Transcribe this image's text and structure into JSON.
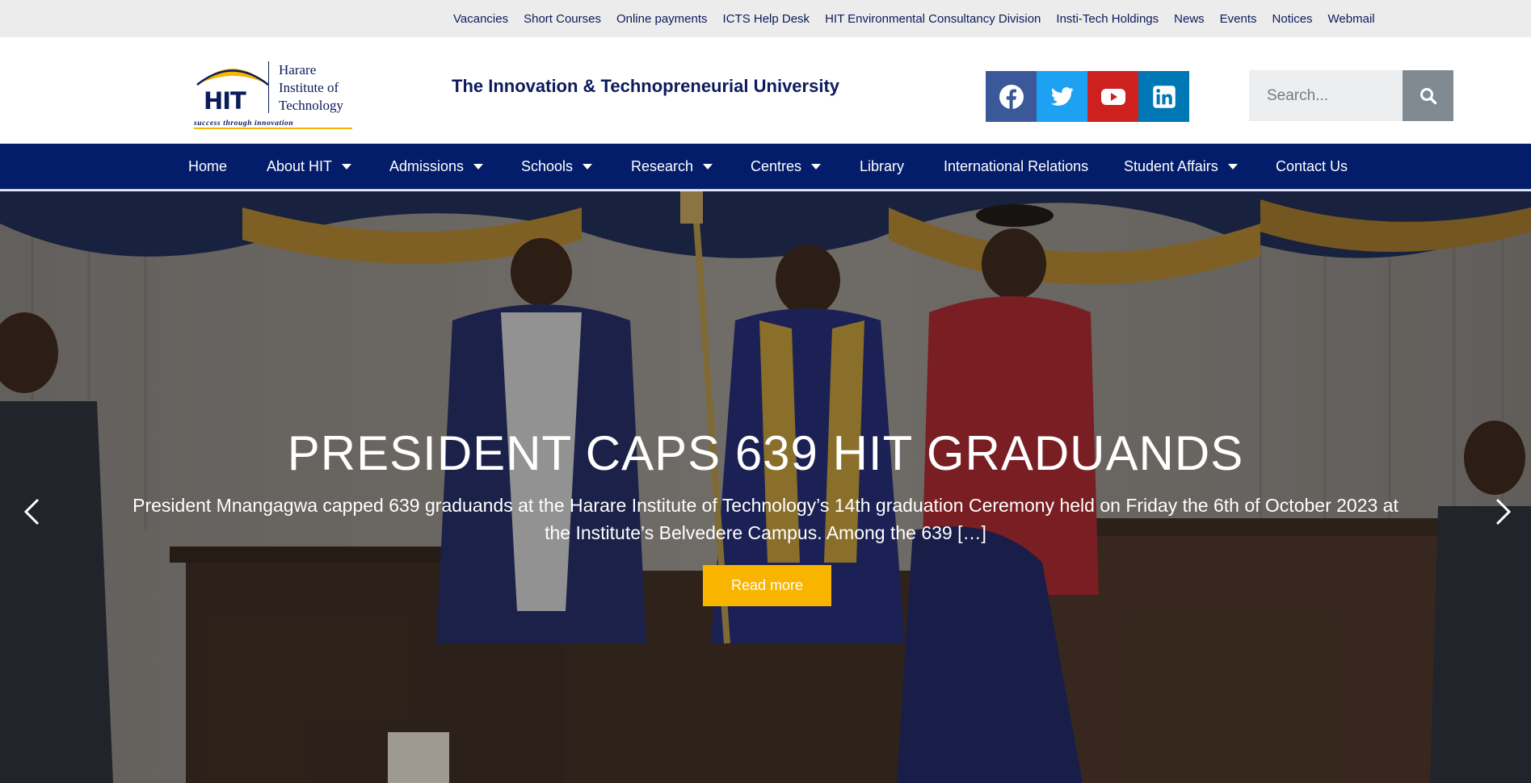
{
  "topbar": {
    "links": [
      "Vacancies",
      "Short Courses",
      "Online payments",
      "ICTS Help Desk",
      "HIT Environmental Consultancy Division",
      "Insti-Tech Holdings",
      "News",
      "Events",
      "Notices",
      "Webmail"
    ]
  },
  "header": {
    "logo": {
      "mark": "HIT",
      "name_line1": "Harare",
      "name_line2": "Institute of",
      "name_line3": "Technology",
      "tagline": "success through innovation"
    },
    "motto": "The Innovation & Technopreneurial University",
    "social": [
      {
        "name": "facebook-icon",
        "color": "#3b5998"
      },
      {
        "name": "twitter-icon",
        "color": "#1da1f2"
      },
      {
        "name": "youtube-icon",
        "color": "#cd201f"
      },
      {
        "name": "linkedin-icon",
        "color": "#0077b5"
      }
    ],
    "search": {
      "placeholder": "Search...",
      "icon": "search-icon"
    }
  },
  "nav": {
    "items": [
      {
        "label": "Home",
        "dropdown": false
      },
      {
        "label": "About HIT",
        "dropdown": true
      },
      {
        "label": "Admissions",
        "dropdown": true
      },
      {
        "label": "Schools",
        "dropdown": true
      },
      {
        "label": "Research",
        "dropdown": true
      },
      {
        "label": "Centres",
        "dropdown": true
      },
      {
        "label": "Library",
        "dropdown": false
      },
      {
        "label": "International Relations",
        "dropdown": false
      },
      {
        "label": "Student Affairs",
        "dropdown": true
      },
      {
        "label": "Contact Us",
        "dropdown": false
      }
    ]
  },
  "hero": {
    "title": "PRESIDENT CAPS 639 HIT GRADUANDS",
    "text": "President Mnangagwa capped 639 graduands at the Harare Institute of Technology’s 14th graduation Ceremony held on Friday the 6th of October 2023 at the Institute’s Belvedere Campus. Among the 639 […]",
    "button": "Read more",
    "prev_icon": "chevron-left-icon",
    "next_icon": "chevron-right-icon"
  },
  "colors": {
    "brand_navy": "#031d6b",
    "accent_yellow": "#f9b400",
    "topbar_bg": "#ececec"
  }
}
